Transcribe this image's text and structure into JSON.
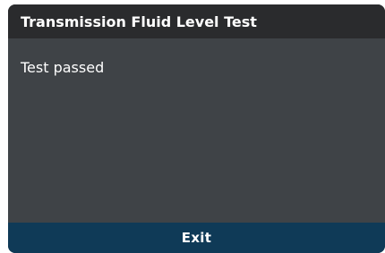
{
  "dialog": {
    "title": "Transmission Fluid Level Test",
    "message": "Test passed",
    "exit_label": "Exit"
  },
  "colors": {
    "title_bar": "#2a2b2d",
    "body": "#3f4347",
    "footer": "#0f3a57",
    "text": "#ffffff"
  }
}
